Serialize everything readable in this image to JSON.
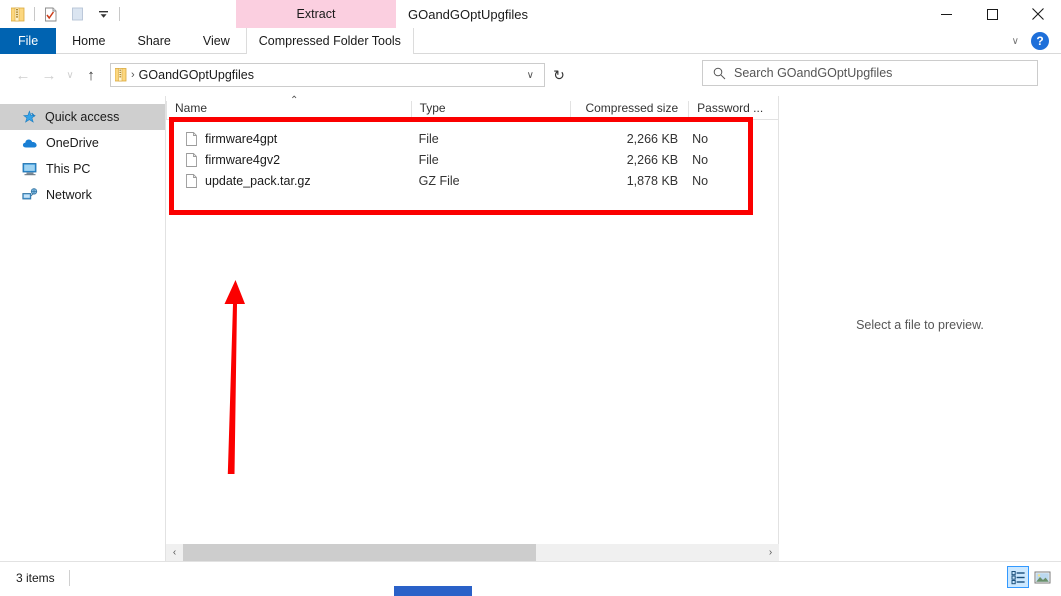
{
  "window": {
    "title": "GOandGOptUpgfiles",
    "contextual_tab_header": "Extract",
    "controls": {
      "minimize": "—",
      "maximize": "☐",
      "close": "✕"
    }
  },
  "quick_access_toolbar": {
    "items": [
      {
        "name": "zip-folder-icon"
      },
      {
        "name": "properties-icon"
      },
      {
        "name": "blank-page-icon"
      },
      {
        "name": "customize-dropdown-icon",
        "glyph": "▾"
      }
    ]
  },
  "ribbon": {
    "tabs": [
      {
        "label": "File",
        "active": true
      },
      {
        "label": "Home",
        "active": false
      },
      {
        "label": "Share",
        "active": false
      },
      {
        "label": "View",
        "active": false
      },
      {
        "label": "Compressed Folder Tools",
        "active": false,
        "contextual": true
      }
    ],
    "collapse_glyph": "∨",
    "help_glyph": "?"
  },
  "address_bar": {
    "back_glyph": "←",
    "forward_glyph": "→",
    "recent_glyph": "∨",
    "up_glyph": "↑",
    "path_icon": "zip-folder-icon",
    "breadcrumb": "GOandGOptUpgfiles",
    "separator": "›",
    "dropdown_glyph": "∨",
    "refresh_glyph": "↻"
  },
  "search": {
    "icon": "search-icon",
    "placeholder": "Search GOandGOptUpgfiles",
    "value": ""
  },
  "sidebar": {
    "items": [
      {
        "label": "Quick access",
        "icon": "pin-star-icon",
        "selected": true
      },
      {
        "label": "OneDrive",
        "icon": "cloud-icon",
        "selected": false
      },
      {
        "label": "This PC",
        "icon": "monitor-icon",
        "selected": false
      },
      {
        "label": "Network",
        "icon": "network-icon",
        "selected": false
      }
    ]
  },
  "file_list": {
    "sort_column": "Name",
    "sort_direction": "ascending",
    "sort_glyph": "⌃",
    "columns": [
      {
        "label": "Name"
      },
      {
        "label": "Type"
      },
      {
        "label": "Compressed size"
      },
      {
        "label": "Password ..."
      }
    ],
    "rows": [
      {
        "icon": "file-icon",
        "name": "firmware4gpt",
        "type": "File",
        "compressed_size": "2,266 KB",
        "password": "No"
      },
      {
        "icon": "file-icon",
        "name": "firmware4gv2",
        "type": "File",
        "compressed_size": "2,266 KB",
        "password": "No"
      },
      {
        "icon": "file-icon",
        "name": "update_pack.tar.gz",
        "type": "GZ File",
        "compressed_size": "1,878 KB",
        "password": "No"
      }
    ],
    "scroll_left_glyph": "‹",
    "scroll_right_glyph": "›"
  },
  "preview_pane": {
    "message": "Select a file to preview."
  },
  "status_bar": {
    "item_count": "3 items",
    "view_buttons": [
      {
        "name": "details-view-button",
        "selected": true
      },
      {
        "name": "large-icons-view-button",
        "selected": false
      }
    ]
  },
  "annotations": {
    "highlight_rect_color": "#fb0000",
    "arrow_color": "#fb0000"
  },
  "colors": {
    "file_tab_blue": "#0063b1",
    "contextual_pink": "#fbcfe0",
    "selection_gray": "#cfcfcf",
    "annotation_red": "#fb0000",
    "taskbar_blue": "#2a61c8"
  }
}
